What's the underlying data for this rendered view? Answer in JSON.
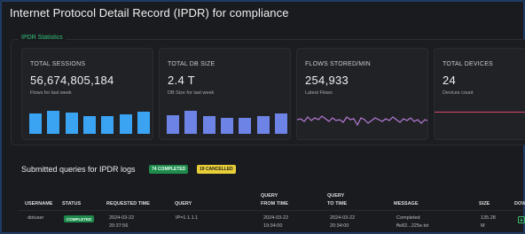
{
  "title": "Internet Protocol Detail Record (IPDR) for compliance",
  "stats": {
    "legend": "IPDR Statistics",
    "cards": [
      {
        "title": "TOTAL SESSIONS",
        "value": "56,674,805,184",
        "sub": "Flows for last week",
        "chart": "bars",
        "color": "#3aa3f2",
        "levels": [
          0.78,
          0.88,
          0.79,
          0.66,
          0.67,
          0.75,
          0.82
        ]
      },
      {
        "title": "TOTAL DB SIZE",
        "value": "2.4 T",
        "sub": "DB Size for last week",
        "chart": "bars",
        "color": "#6d84e6",
        "levels": [
          0.7,
          0.86,
          0.68,
          0.6,
          0.6,
          0.66,
          0.76
        ]
      },
      {
        "title": "FLOWS STORED/MIN",
        "value": "254,933",
        "sub": "Latest Flows",
        "chart": "line",
        "color": "#b67ad6"
      },
      {
        "title": "TOTAL DEVICES",
        "value": "24",
        "sub": "Devices count",
        "chart": "flat",
        "color": "#d7486a"
      }
    ]
  },
  "queries": {
    "title": "Submitted queries for IPDR logs",
    "completed_badge": "74 COMPLETED",
    "cancelled_badge": "19 CANCELLED",
    "headers": {
      "username": "USERNAME",
      "status": "STATUS",
      "requested_time": "REQUESTED TIME",
      "query": "QUERY",
      "from_time_1": "QUERY",
      "from_time_2": "FROM TIME",
      "to_time_1": "QUERY",
      "to_time_2": "TO TIME",
      "message": "MESSAGE",
      "size": "SIZE",
      "download": "DOW"
    },
    "rows": [
      {
        "username": "dotuser",
        "status": "COMPLETED",
        "requested_date": "2024-03-22",
        "requested_clock": "20:37:56",
        "query": "IP=1.1.1.1",
        "from_date": "2024-03-22",
        "from_clock": "19:34:00",
        "to_date": "2024-03-22",
        "to_clock": "20:34:00",
        "message_1": "Completed",
        "message_2": "ffe82...225e.txt",
        "size_1": "135.28",
        "size_2": "M"
      }
    ]
  }
}
